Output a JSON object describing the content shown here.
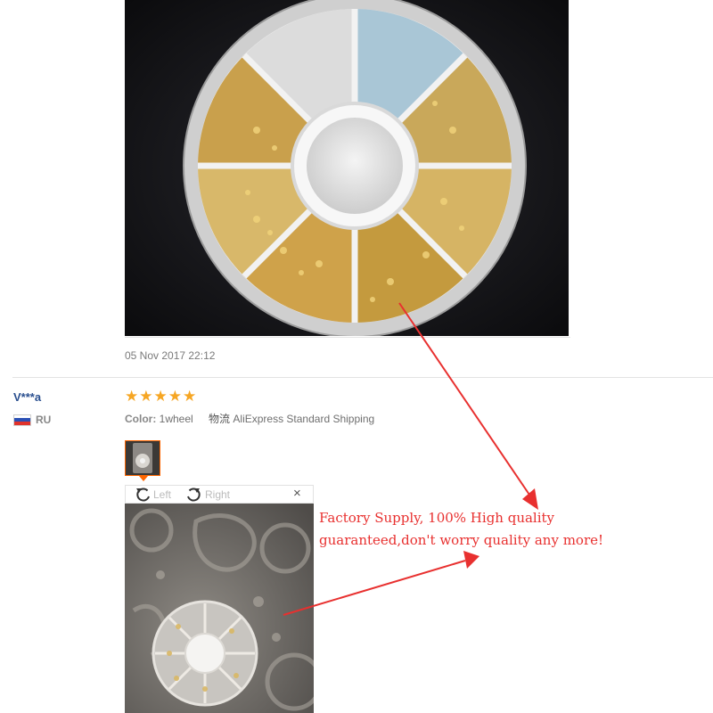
{
  "review": {
    "date": "05 Nov 2017 22:12"
  },
  "reviewer": {
    "name": "V***a",
    "country_code": "RU",
    "country_flag_colors": [
      "#ffffff",
      "#2b50b5",
      "#e0322b"
    ],
    "rating": 5,
    "stars": [
      "★",
      "★",
      "★",
      "★",
      "★"
    ],
    "star_color": "#f6a623"
  },
  "attributes": {
    "color_label": "Color:",
    "color_value": "1wheel",
    "shipping_label": "物流",
    "shipping_value": "AliExpress Standard Shipping"
  },
  "image_viewer": {
    "rotate_left_label": "Left",
    "rotate_right_label": "Right",
    "close_symbol": "×",
    "rotate_left_icon": "rotate-left-icon",
    "rotate_right_icon": "rotate-right-icon"
  },
  "annotation": {
    "line1": "Factory Supply, 100% High quality",
    "line2": "guaranteed,don't worry quality any more!",
    "color": "#e8302f"
  },
  "colors": {
    "accent_orange": "#ff6600",
    "link_blue": "#2a4f8f"
  }
}
